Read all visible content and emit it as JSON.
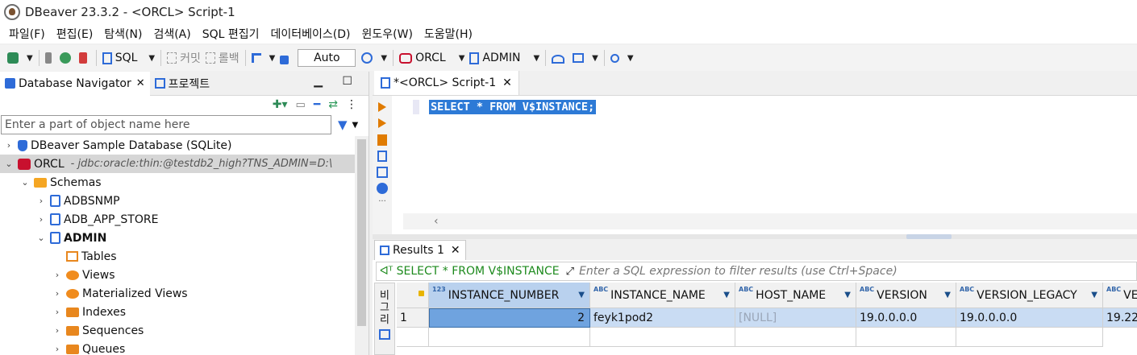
{
  "window": {
    "title": "DBeaver 23.3.2 - <ORCL> Script-1"
  },
  "menu": [
    "파일(F)",
    "편집(E)",
    "탐색(N)",
    "검색(A)",
    "SQL 편집기",
    "데이터베이스(D)",
    "윈도우(W)",
    "도움말(H)"
  ],
  "toolbar": {
    "sql_label": "SQL",
    "commit_label": "커밋",
    "rollback_label": "롤백",
    "auto_label": "Auto",
    "datasource_label": "ORCL",
    "schema_label": "ADMIN"
  },
  "navigator": {
    "tab_label": "Database Navigator",
    "project_tab_label": "프로젝트",
    "filter_placeholder": "Enter a part of object name here",
    "tree": {
      "sample_db": "DBeaver Sample Database (SQLite)",
      "orcl": "ORCL",
      "orcl_url": "- jdbc:oracle:thin:@testdb2_high?TNS_ADMIN=D:\\",
      "schemas": "Schemas",
      "adbsnmp": "ADBSNMP",
      "adb_app_store": "ADB_APP_STORE",
      "admin": "ADMIN",
      "tables": "Tables",
      "views": "Views",
      "mviews": "Materialized Views",
      "indexes": "Indexes",
      "sequences": "Sequences",
      "queues": "Queues"
    }
  },
  "editor": {
    "tab_label": "*<ORCL> Script-1",
    "code": "SELECT * FROM V$INSTANCE;"
  },
  "results": {
    "tab_label": "Results 1",
    "query": "SELECT * FROM V$INSTANCE",
    "filter_placeholder": "Enter a SQL expression to filter results (use Ctrl+Space)",
    "side_label": "비\n그\n리",
    "type_num": "123",
    "type_abc": "ABC",
    "columns": [
      "INSTANCE_NUMBER",
      "INSTANCE_NAME",
      "HOST_NAME",
      "VERSION",
      "VERSION_LEGACY",
      "VE"
    ],
    "row": {
      "num": "1",
      "instance_number": "2",
      "instance_name": "feyk1pod2",
      "host_name": "[NULL]",
      "version": "19.0.0.0.0",
      "version_legacy": "19.0.0.0.0",
      "ve": "19.22."
    }
  }
}
